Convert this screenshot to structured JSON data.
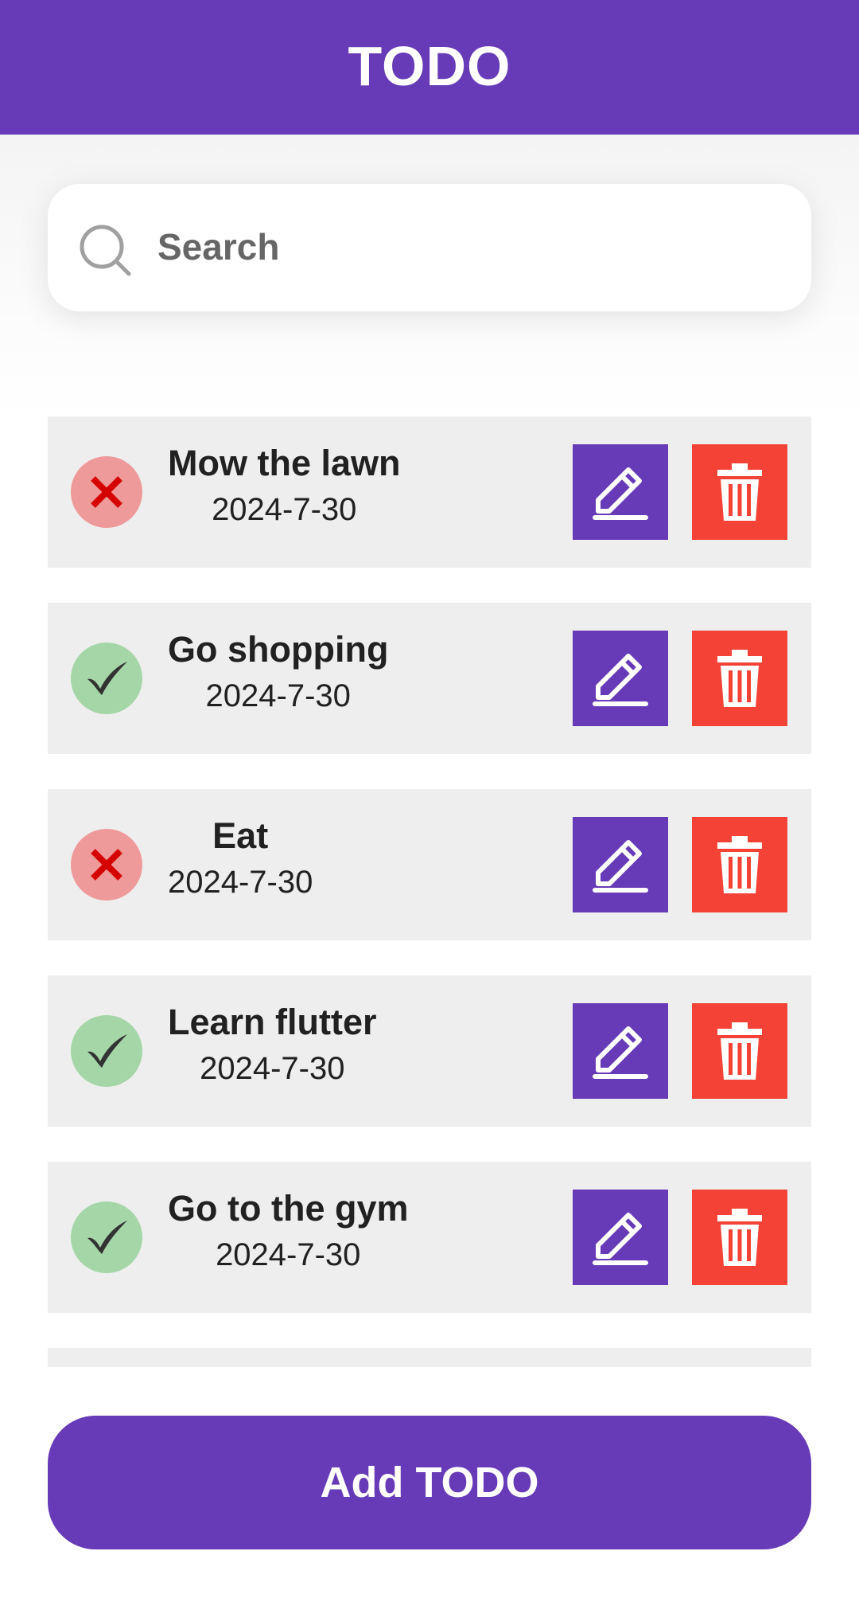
{
  "appbar": {
    "title": "TODO"
  },
  "search": {
    "placeholder": "Search"
  },
  "todos": [
    {
      "title": "Mow the lawn",
      "date": "2024-7-30",
      "done": false
    },
    {
      "title": "Go shopping",
      "date": "2024-7-30",
      "done": true
    },
    {
      "title": "Eat",
      "date": "2024-7-30",
      "done": false
    },
    {
      "title": "Learn flutter",
      "date": "2024-7-30",
      "done": true
    },
    {
      "title": "Go to the gym",
      "date": "2024-7-30",
      "done": true
    }
  ],
  "footer": {
    "add_label": "Add TODO"
  },
  "icons": {
    "search": "search-icon",
    "done": "check-icon",
    "not_done": "cross-icon",
    "edit": "pencil-icon",
    "delete": "trash-icon"
  },
  "colors": {
    "primary": "#673ab7",
    "delete": "#f44336",
    "done_bg": "#a5d6a7",
    "not_done_bg": "#ef9a9a",
    "item_bg": "#eeeeee"
  }
}
